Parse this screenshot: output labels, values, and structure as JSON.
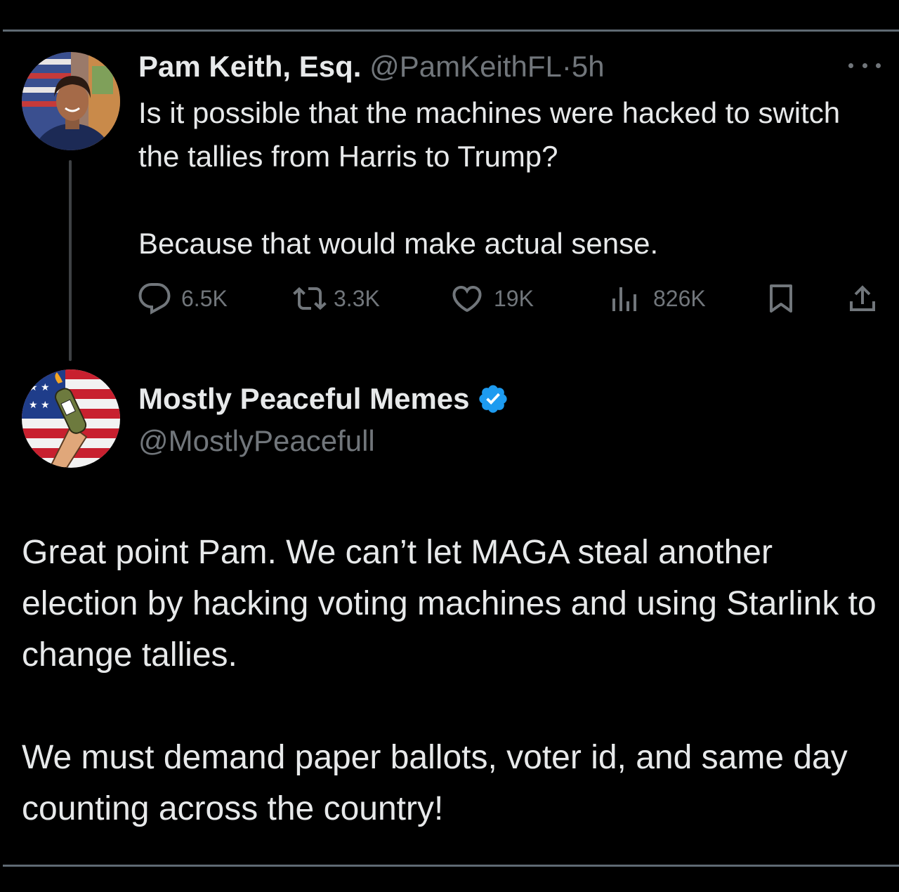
{
  "tweet": {
    "author_name": "Pam Keith, Esq.",
    "handle": "@PamKeithFL",
    "separator": "·",
    "time": "5h",
    "paragraphs": [
      "Is it possible that the machines were hacked to switch the tallies from Harris to Trump?",
      "Because that would make actual sense."
    ],
    "stats": {
      "replies": "6.5K",
      "reposts": "3.3K",
      "likes": "19K",
      "views": "826K"
    }
  },
  "reply": {
    "author_name": "Mostly Peaceful Memes",
    "handle": "@MostlyPeacefull",
    "verified": true,
    "paragraphs": [
      "Great point Pam. We can’t let MAGA steal another election by hacking voting machines and using Starlink to change tallies.",
      "We must demand paper ballots, voter id, and same day counting across the country!"
    ]
  },
  "colors": {
    "background": "#000000",
    "text": "#e7e9ea",
    "muted": "#71767b",
    "verified": "#1d9bf0"
  },
  "icons": {
    "reply": "reply-icon",
    "repost": "repost-icon",
    "like": "like-icon",
    "views": "views-icon",
    "bookmark": "bookmark-icon",
    "share": "share-icon",
    "more": "more-icon",
    "verified": "verified-badge-icon"
  }
}
